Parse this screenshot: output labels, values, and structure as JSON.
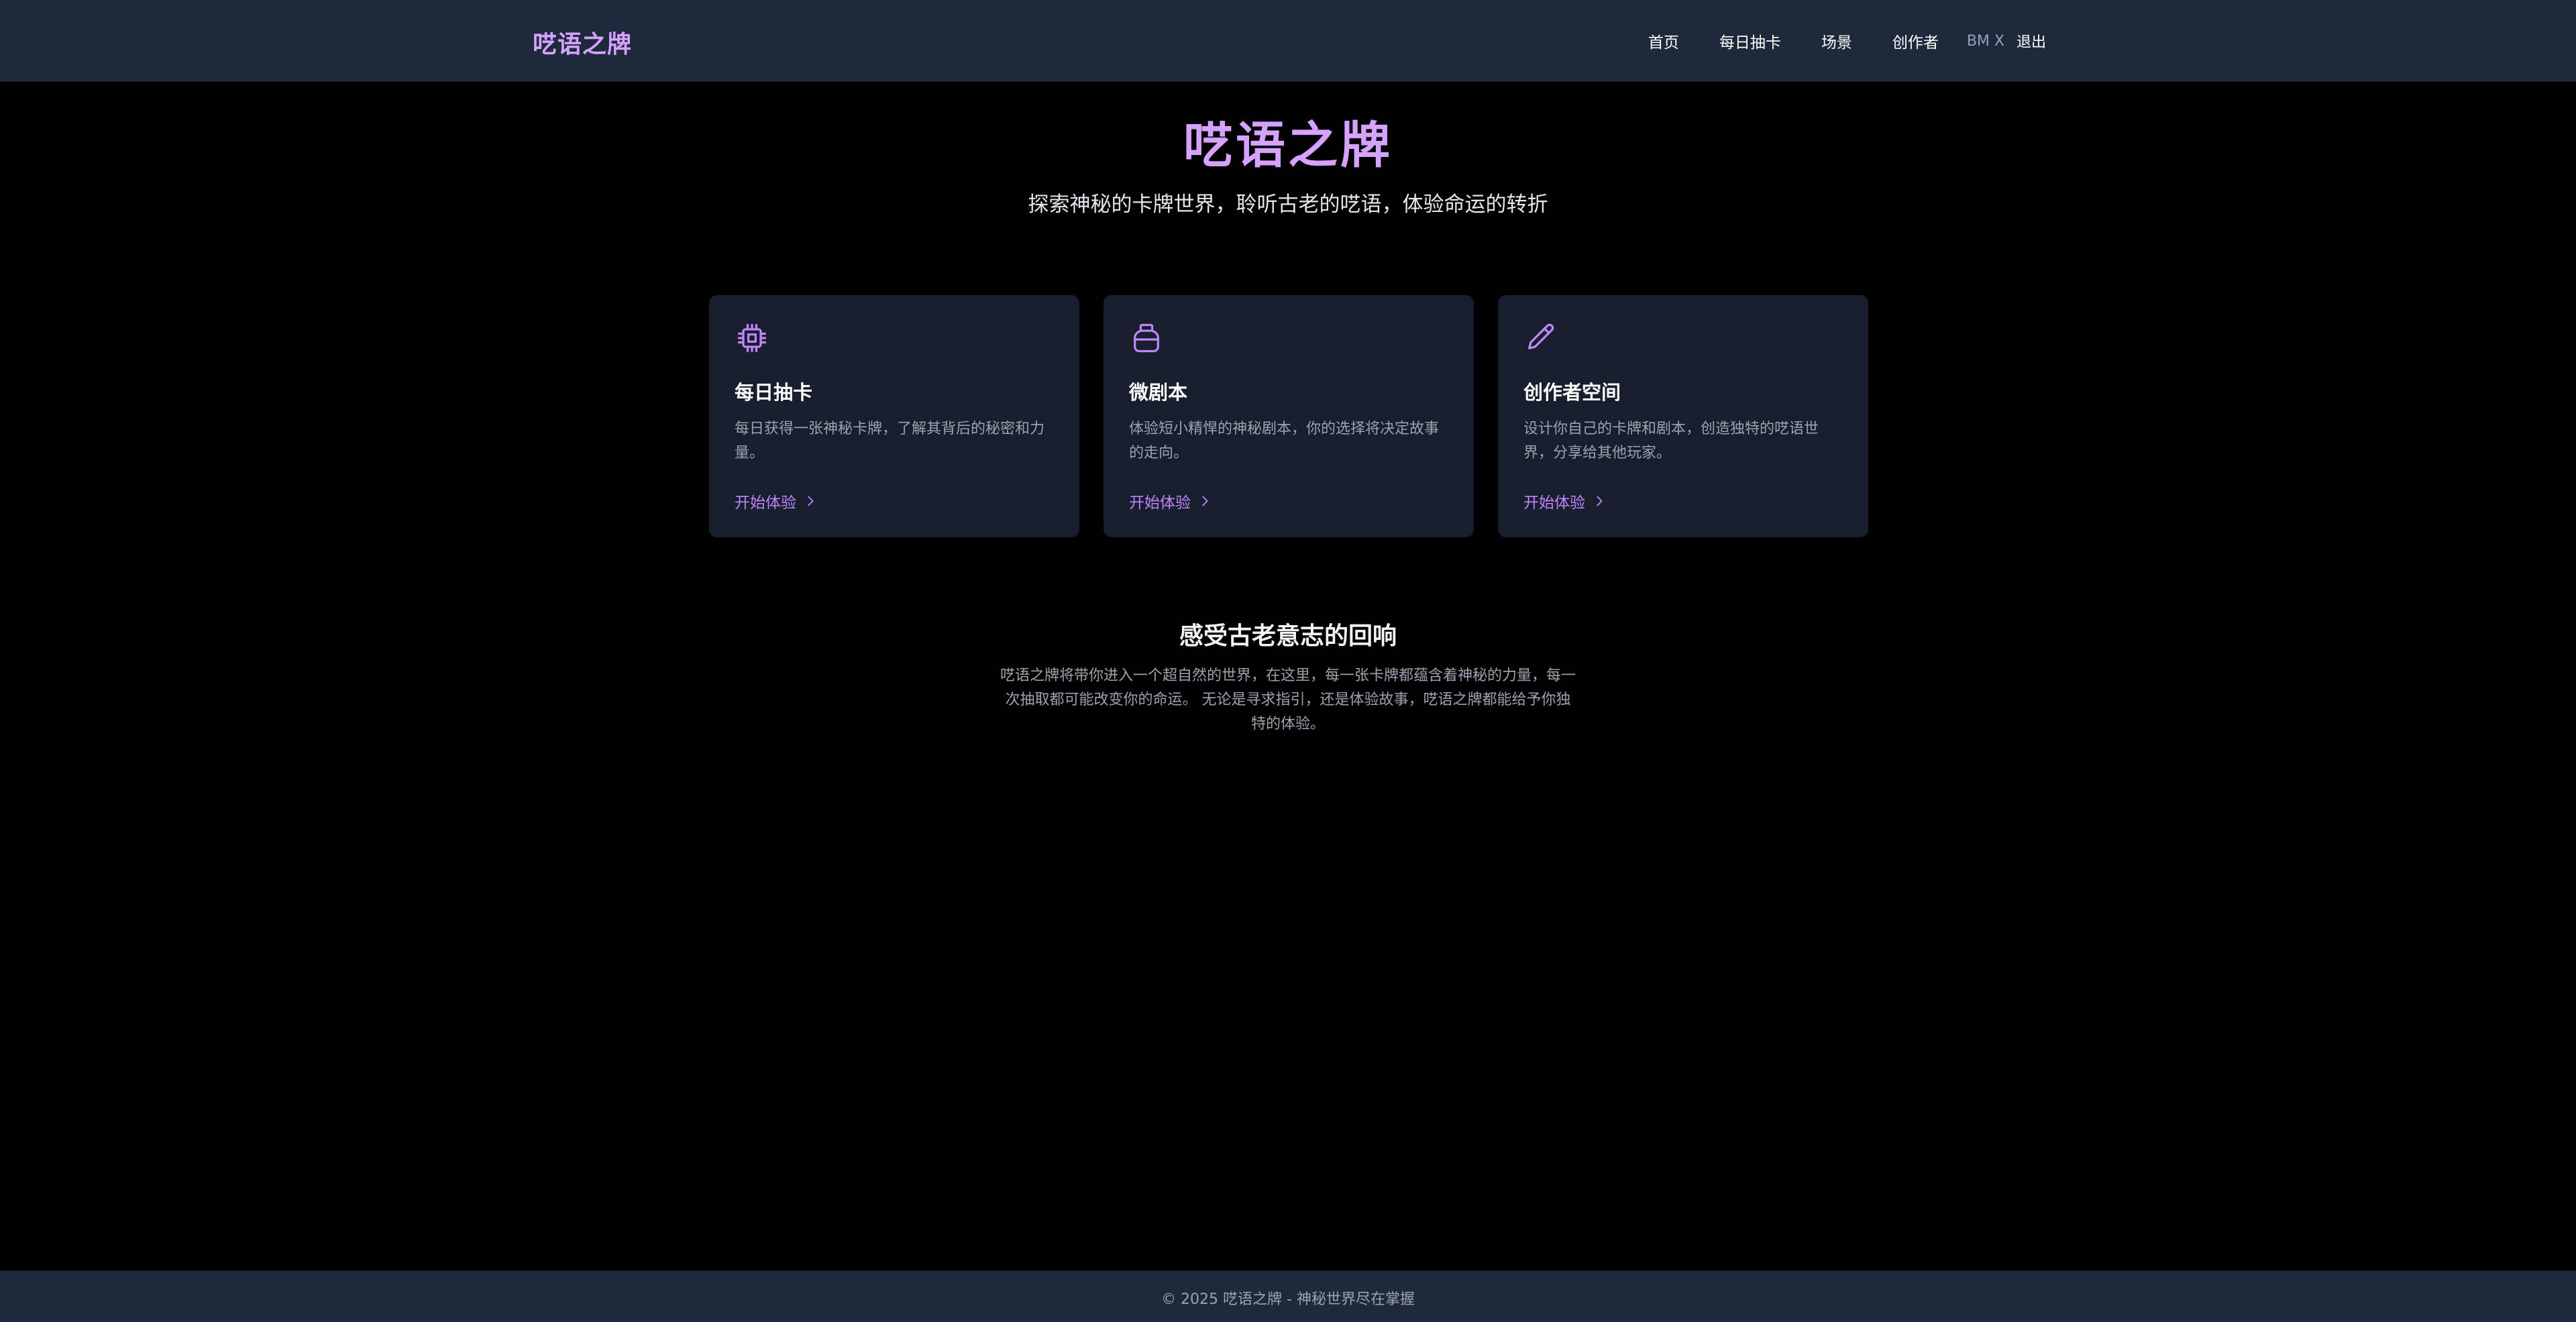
{
  "header": {
    "brand": "呓语之牌",
    "nav": [
      {
        "label": "首页"
      },
      {
        "label": "每日抽卡"
      },
      {
        "label": "场景"
      },
      {
        "label": "创作者"
      }
    ],
    "user": "BM X",
    "logout_label": "退出"
  },
  "hero": {
    "title": "呓语之牌",
    "subtitle": "探索神秘的卡牌世界，聆听古老的呓语，体验命运的转折"
  },
  "cards": [
    {
      "icon": "chip-icon",
      "title": "每日抽卡",
      "description": "每日获得一张神秘卡牌，了解其背后的秘密和力量。",
      "link_label": "开始体验"
    },
    {
      "icon": "ink-bottle-icon",
      "title": "微剧本",
      "description": "体验短小精悍的神秘剧本，你的选择将决定故事的走向。",
      "link_label": "开始体验"
    },
    {
      "icon": "pencil-icon",
      "title": "创作者空间",
      "description": "设计你自己的卡牌和剧本，创造独特的呓语世界，分享给其他玩家。",
      "link_label": "开始体验"
    }
  ],
  "about": {
    "title": "感受古老意志的回响",
    "text": "呓语之牌将带你进入一个超自然的世界，在这里，每一张卡牌都蕴含着神秘的力量，每一次抽取都可能改变你的命运。 无论是寻求指引，还是体验故事，呓语之牌都能给予你独特的体验。"
  },
  "footer": {
    "text": "© 2025 呓语之牌 - 神秘世界尽在掌握"
  },
  "colors": {
    "accent": "#c084fc",
    "header_bg": "#1e293b",
    "card_bg": "#171f2e",
    "page_bg": "#000000"
  }
}
